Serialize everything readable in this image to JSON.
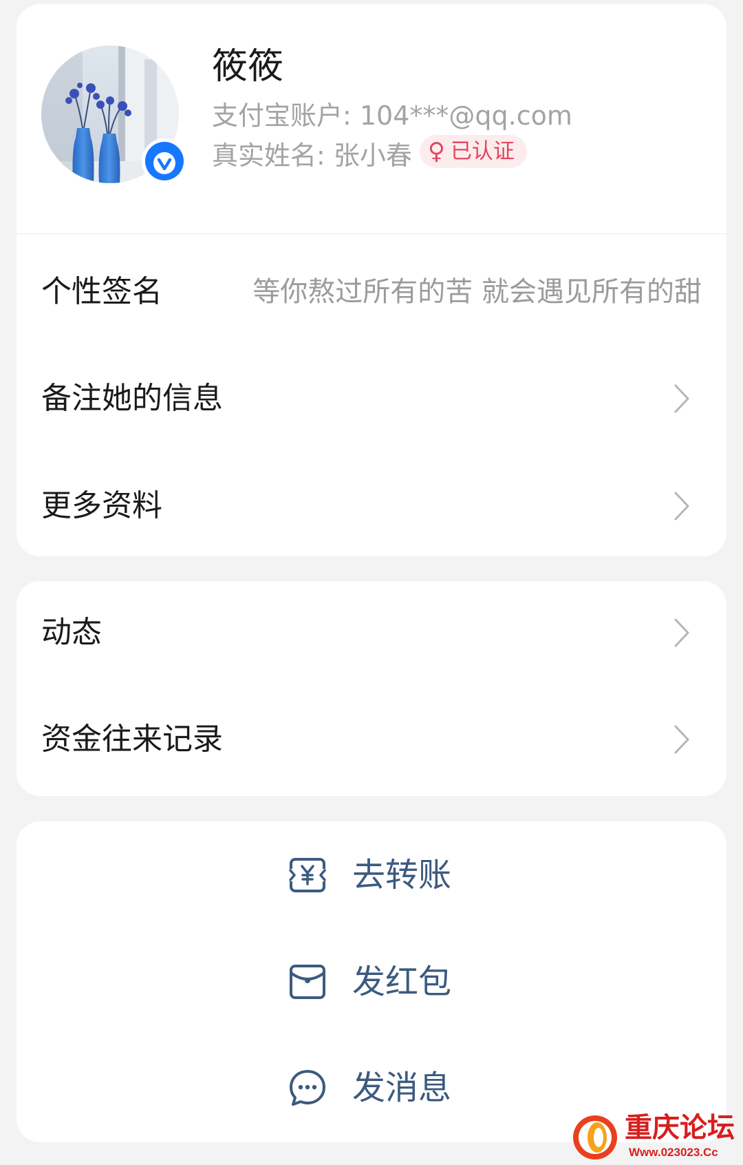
{
  "profile": {
    "name": "筱筱",
    "account_line": "支付宝账户: 104***@qq.com",
    "realname_line": "真实姓名: 张小春",
    "auth_badge": {
      "gender_symbol": "♀",
      "label": "已认证"
    }
  },
  "details": {
    "signature_label": "个性签名",
    "signature_value": "等你熬过所有的苦 就会遇见所有的甜",
    "remark_label": "备注她的信息",
    "more_info_label": "更多资料"
  },
  "activity": {
    "moments_label": "动态",
    "fund_records_label": "资金往来记录"
  },
  "actions": [
    {
      "label": "去转账",
      "icon": "transfer-icon"
    },
    {
      "label": "发红包",
      "icon": "red-envelope-icon"
    },
    {
      "label": "发消息",
      "icon": "message-icon"
    }
  ],
  "watermark": {
    "title": "重庆论坛",
    "url": "Www.023023.Cc"
  },
  "colors": {
    "background": "#f3f3f3",
    "card": "#ffffff",
    "action_blue": "#3c5a7f",
    "badge_pink": "#e04660",
    "verified_blue": "#1677ff",
    "watermark_red": "#d81e1e"
  }
}
